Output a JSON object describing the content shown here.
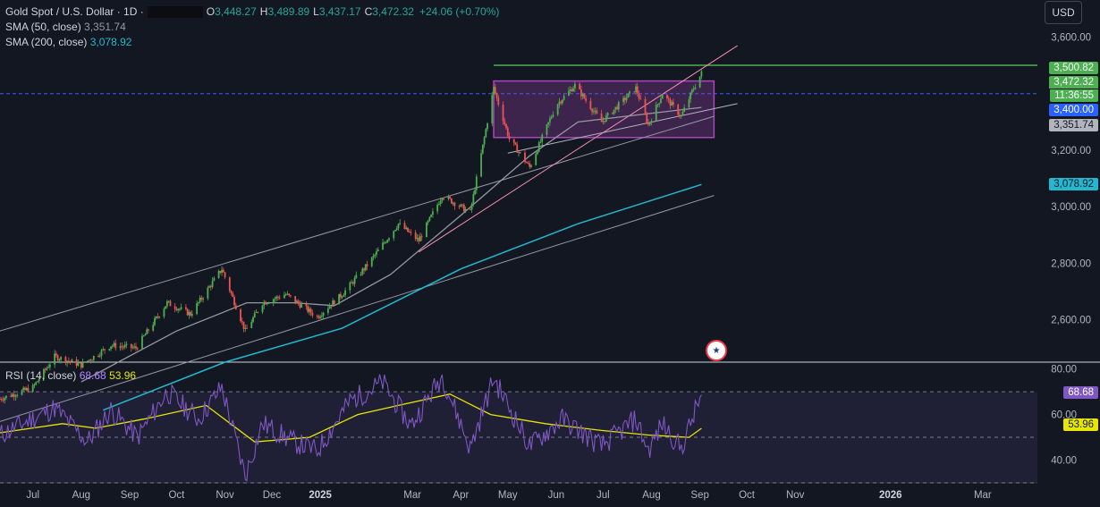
{
  "header": {
    "symbol": "Gold Spot / U.S. Dollar · 1D ·",
    "open_key": "O",
    "open": "3,448.27",
    "high_key": "H",
    "high": "3,489.89",
    "low_key": "L",
    "low": "3,437.17",
    "close_key": "C",
    "close": "3,472.32",
    "change": "+24.06 (+0.70%)",
    "sma50_label": "SMA (50, close)",
    "sma50_value": "3,351.74",
    "sma200_label": "SMA (200, close)",
    "sma200_value": "3,078.92",
    "currency": "USD"
  },
  "price_tags": {
    "high_line": "3,500.82",
    "last": "3,472.32",
    "countdown": "11:36:55",
    "level": "3,400.00",
    "sma50": "3,351.74",
    "sma200": "3,078.92"
  },
  "rsi_header": {
    "label": "RSI (14, close)",
    "rsi": "68.68",
    "ma": "53.96"
  },
  "rsi_tags": {
    "rsi": "68.68",
    "ma": "53.96"
  },
  "colors": {
    "background": "#131722",
    "up": "#26a69a",
    "up_bright": "#4caf50",
    "down": "#ef5350",
    "sma50": "#9598a1",
    "sma200": "#22b8cf",
    "rsi": "#7e57c2",
    "rsi_ma": "#e6e600",
    "box": "#ab47bc",
    "high_line": "#4caf50",
    "level_line": "#2962ff"
  },
  "chart_data": [
    {
      "type": "candlestick",
      "title": "Gold Spot / U.S. Dollar · 1D",
      "xlabel": "",
      "ylabel": "",
      "ylim": [
        2450,
        3700
      ],
      "y_ticks": [
        "3,600.00",
        "3,400.00",
        "3,200.00",
        "3,000.00",
        "2,800.00",
        "2,600.00"
      ],
      "y_tick_values": [
        3600,
        3400,
        3200,
        3000,
        2800,
        2600
      ],
      "x_ticks": [
        "Jul",
        "Aug",
        "Sep",
        "Oct",
        "Nov",
        "Dec",
        "2025",
        "Mar",
        "Apr",
        "May",
        "Jun",
        "Jul",
        "Aug",
        "Sep",
        "Oct",
        "Nov",
        "2026",
        "Mar"
      ],
      "x_tick_dates": [
        "2024-07-01",
        "2024-08-01",
        "2024-09-01",
        "2024-10-01",
        "2024-11-01",
        "2024-12-01",
        "2025-01-01",
        "2025-03-01",
        "2025-04-01",
        "2025-05-01",
        "2025-06-01",
        "2025-07-01",
        "2025-08-01",
        "2025-09-01",
        "2025-10-01",
        "2025-11-01",
        "2026-01-01",
        "2026-03-01"
      ],
      "x_range": [
        "2024-06-10",
        "2026-04-05"
      ],
      "approx_close_path": [
        {
          "date": "2024-06-10",
          "value": 2320
        },
        {
          "date": "2024-07-01",
          "value": 2360
        },
        {
          "date": "2024-07-15",
          "value": 2470
        },
        {
          "date": "2024-08-01",
          "value": 2440
        },
        {
          "date": "2024-08-20",
          "value": 2510
        },
        {
          "date": "2024-09-05",
          "value": 2500
        },
        {
          "date": "2024-09-25",
          "value": 2660
        },
        {
          "date": "2024-10-10",
          "value": 2620
        },
        {
          "date": "2024-10-30",
          "value": 2780
        },
        {
          "date": "2024-11-14",
          "value": 2560
        },
        {
          "date": "2024-11-25",
          "value": 2660
        },
        {
          "date": "2024-12-10",
          "value": 2690
        },
        {
          "date": "2024-12-30",
          "value": 2610
        },
        {
          "date": "2025-01-15",
          "value": 2690
        },
        {
          "date": "2025-02-01",
          "value": 2800
        },
        {
          "date": "2025-02-20",
          "value": 2940
        },
        {
          "date": "2025-03-05",
          "value": 2880
        },
        {
          "date": "2025-03-20",
          "value": 3040
        },
        {
          "date": "2025-04-07",
          "value": 2980
        },
        {
          "date": "2025-04-22",
          "value": 3420
        },
        {
          "date": "2025-05-02",
          "value": 3240
        },
        {
          "date": "2025-05-15",
          "value": 3140
        },
        {
          "date": "2025-06-01",
          "value": 3360
        },
        {
          "date": "2025-06-13",
          "value": 3430
        },
        {
          "date": "2025-06-30",
          "value": 3300
        },
        {
          "date": "2025-07-22",
          "value": 3420
        },
        {
          "date": "2025-07-30",
          "value": 3290
        },
        {
          "date": "2025-08-08",
          "value": 3400
        },
        {
          "date": "2025-08-20",
          "value": 3320
        },
        {
          "date": "2025-08-28",
          "value": 3420
        },
        {
          "date": "2025-09-02",
          "value": 3472.32
        }
      ],
      "sma50": [
        {
          "date": "2024-08-01",
          "value": 2380
        },
        {
          "date": "2024-10-01",
          "value": 2560
        },
        {
          "date": "2024-11-15",
          "value": 2660
        },
        {
          "date": "2024-12-15",
          "value": 2660
        },
        {
          "date": "2025-01-10",
          "value": 2650
        },
        {
          "date": "2025-02-15",
          "value": 2760
        },
        {
          "date": "2025-04-01",
          "value": 2970
        },
        {
          "date": "2025-05-15",
          "value": 3180
        },
        {
          "date": "2025-06-15",
          "value": 3300
        },
        {
          "date": "2025-09-02",
          "value": 3351.74
        }
      ],
      "sma200": [
        {
          "date": "2024-08-15",
          "value": 2280
        },
        {
          "date": "2024-11-01",
          "value": 2450
        },
        {
          "date": "2025-01-15",
          "value": 2570
        },
        {
          "date": "2025-04-01",
          "value": 2780
        },
        {
          "date": "2025-06-15",
          "value": 2940
        },
        {
          "date": "2025-09-02",
          "value": 3078.92
        }
      ],
      "annotations": {
        "horizontal_high": 3500.82,
        "horizontal_level": 3400.0,
        "range_box": {
          "start": "2025-04-22",
          "end": "2025-09-10",
          "top": 3445,
          "bottom": 3245
        },
        "channel_upper": [
          {
            "date": "2024-06-10",
            "value": 2560
          },
          {
            "date": "2025-09-10",
            "value": 3320
          }
        ],
        "channel_lower": [
          {
            "date": "2024-06-10",
            "value": 2240
          },
          {
            "date": "2025-09-10",
            "value": 3040
          }
        ],
        "trend_line": [
          {
            "date": "2025-03-05",
            "value": 2840
          },
          {
            "date": "2025-09-25",
            "value": 3570
          }
        ],
        "wedge_lower": [
          {
            "date": "2025-05-01",
            "value": 3190
          },
          {
            "date": "2025-09-25",
            "value": 3365
          }
        ]
      }
    },
    {
      "type": "line",
      "title": "RSI (14, close)",
      "xlabel": "",
      "ylabel": "",
      "ylim": [
        30,
        83
      ],
      "y_ticks": [
        "80.00",
        "60.00",
        "40.00"
      ],
      "y_tick_values": [
        80,
        60,
        40
      ],
      "levels": [
        70,
        50,
        30
      ],
      "series": [
        {
          "name": "RSI",
          "values_approx": [
            {
              "date": "2024-06-10",
              "value": 51
            },
            {
              "date": "2024-07-15",
              "value": 63
            },
            {
              "date": "2024-08-05",
              "value": 48
            },
            {
              "date": "2024-08-20",
              "value": 62
            },
            {
              "date": "2024-09-06",
              "value": 50
            },
            {
              "date": "2024-09-25",
              "value": 70
            },
            {
              "date": "2024-10-15",
              "value": 58
            },
            {
              "date": "2024-10-30",
              "value": 72
            },
            {
              "date": "2024-11-14",
              "value": 33
            },
            {
              "date": "2024-11-25",
              "value": 56
            },
            {
              "date": "2024-12-15",
              "value": 48
            },
            {
              "date": "2024-12-30",
              "value": 44
            },
            {
              "date": "2025-01-20",
              "value": 66
            },
            {
              "date": "2025-02-10",
              "value": 74
            },
            {
              "date": "2025-02-28",
              "value": 55
            },
            {
              "date": "2025-03-20",
              "value": 77
            },
            {
              "date": "2025-04-07",
              "value": 45
            },
            {
              "date": "2025-04-22",
              "value": 76
            },
            {
              "date": "2025-05-15",
              "value": 46
            },
            {
              "date": "2025-06-05",
              "value": 58
            },
            {
              "date": "2025-06-30",
              "value": 46
            },
            {
              "date": "2025-07-22",
              "value": 58
            },
            {
              "date": "2025-07-30",
              "value": 44
            },
            {
              "date": "2025-08-08",
              "value": 56
            },
            {
              "date": "2025-08-20",
              "value": 45
            },
            {
              "date": "2025-09-02",
              "value": 68.68
            }
          ]
        },
        {
          "name": "RSI-based MA",
          "values_approx": [
            {
              "date": "2024-06-10",
              "value": 52
            },
            {
              "date": "2024-07-20",
              "value": 56
            },
            {
              "date": "2024-08-10",
              "value": 54
            },
            {
              "date": "2024-09-10",
              "value": 58
            },
            {
              "date": "2024-10-20",
              "value": 64
            },
            {
              "date": "2024-11-20",
              "value": 48
            },
            {
              "date": "2024-12-25",
              "value": 50
            },
            {
              "date": "2025-01-25",
              "value": 60
            },
            {
              "date": "2025-02-20",
              "value": 64
            },
            {
              "date": "2025-03-25",
              "value": 69
            },
            {
              "date": "2025-04-20",
              "value": 60
            },
            {
              "date": "2025-05-25",
              "value": 56
            },
            {
              "date": "2025-06-30",
              "value": 53
            },
            {
              "date": "2025-07-30",
              "value": 51
            },
            {
              "date": "2025-08-25",
              "value": 50
            },
            {
              "date": "2025-09-02",
              "value": 53.96
            }
          ]
        }
      ]
    }
  ]
}
